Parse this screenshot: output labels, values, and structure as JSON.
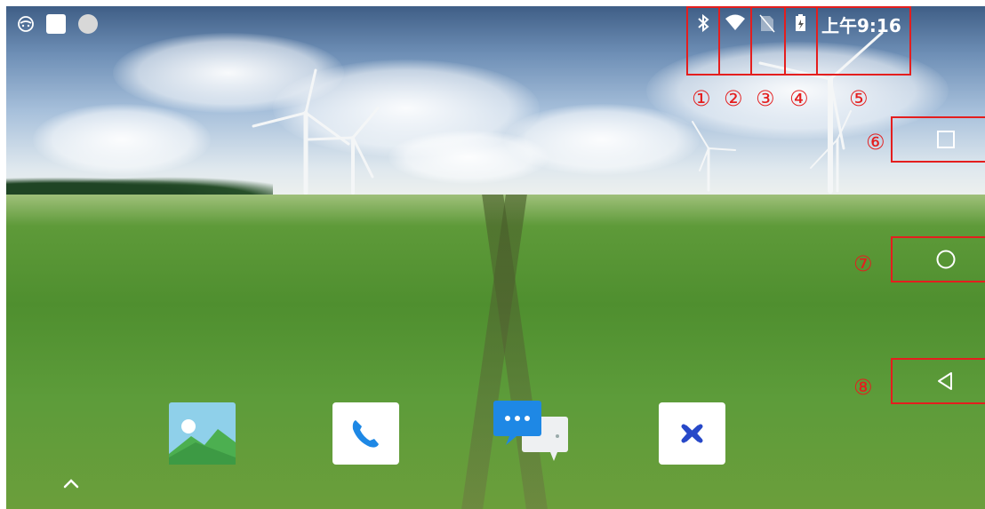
{
  "status_bar": {
    "left_icons": [
      "mask-icon",
      "square-icon",
      "circle-icon"
    ],
    "right_icons": [
      "bluetooth-icon",
      "wifi-icon",
      "no-sim-icon",
      "battery-icon"
    ],
    "time": "上午9:16"
  },
  "annotations": [
    "①",
    "②",
    "③",
    "④",
    "⑤",
    "⑥",
    "⑦",
    "⑧"
  ],
  "nav_bar": [
    "recents-icon",
    "home-icon",
    "back-icon"
  ],
  "dock": [
    "gallery-icon",
    "phone-icon",
    "messages-icon",
    "x-app-icon"
  ],
  "app_drawer_icon": "chevron-up-icon",
  "colors": {
    "annotation": "#e41e1e",
    "dock_phone": "#1e88e5",
    "dock_messages": "#1e88e5",
    "dock_x": "#2748c8"
  }
}
